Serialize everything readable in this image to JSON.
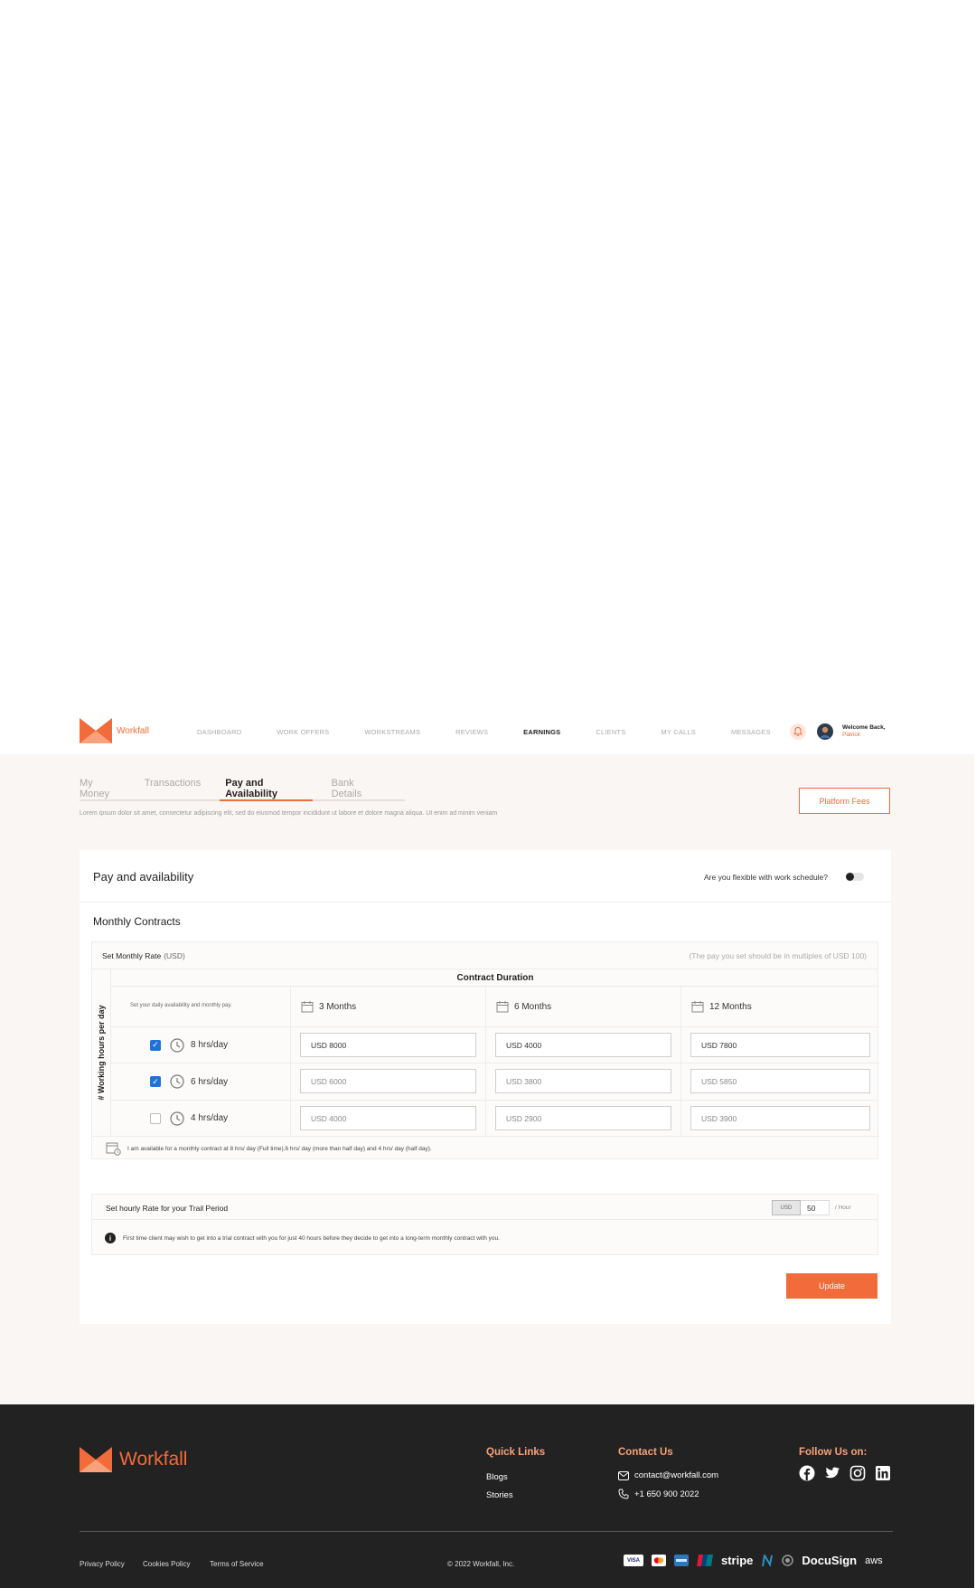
{
  "brand": {
    "name": "Workfall",
    "accent": "#f26b3a"
  },
  "nav": {
    "items": [
      "DASHBOARD",
      "WORK OFFERS",
      "WORKSTREAMS",
      "REVIEWS",
      "EARNINGS",
      "CLIENTS",
      "MY CALLS",
      "MESSAGES"
    ],
    "active": "EARNINGS"
  },
  "user": {
    "welcome": "Welcome Back,",
    "name": "Patrick"
  },
  "tabs": [
    "My Money",
    "Transactions",
    "Pay and Availability",
    "Bank Details"
  ],
  "page": {
    "subtitle": "Lorem ipsum dolor sit amet, consectetur adipiscing elit, sed do eiusmod tempor incididunt ut labore et dolore magna aliqua. Ut enim ad minim veniam",
    "platform_fees": "Platform Fees"
  },
  "card": {
    "title": "Pay and availability",
    "flexible_question": "Are you flexible with work schedule?",
    "monthly_title": "Monthly Contracts",
    "rate_label": "Set Monthly Rate",
    "rate_currency": "(USD)",
    "rate_note": "(The pay you set should be in multiples of USD 100)",
    "vertical_label": "# Working hours per day",
    "contract_duration": "Contract Duration",
    "availability_hint": "Set your daily availability and monthly pay.",
    "durations": [
      "3 Months",
      "6 Months",
      "12 Months"
    ],
    "rows": [
      {
        "hours": "8 hrs/day",
        "checked": true,
        "values": [
          "USD 8000",
          "USD 4000",
          "USD 7800"
        ]
      },
      {
        "hours": "6 hrs/day",
        "checked": true,
        "values": [
          "USD 6000",
          "USD 3800",
          "USD 5850"
        ]
      },
      {
        "hours": "4 hrs/day",
        "checked": false,
        "values": [
          "USD 4000",
          "USD 2900",
          "USD 3900"
        ]
      }
    ],
    "availability_note": "I am available for a monthly contract at 8 hrs/ day (Full time),6 hrs/ day (more than half day) and 4 hrs/ day (half day).",
    "trial_label": "Set hourly Rate for your Trail Period",
    "trial_currency": "USD",
    "trial_value": "50",
    "trial_unit": "/ Hour",
    "trial_note": "First time client may wish to get into a trial contract with you for just 40 hours before they decide to get into a long-term monthly contract with you.",
    "update": "Update"
  },
  "footer": {
    "brand": "Workfall",
    "quick_links_title": "Quick Links",
    "quick_links": [
      "Blogs",
      "Stories"
    ],
    "contact_title": "Contact Us",
    "email": "contact@workfall.com",
    "phone": "+1 650 900 2022",
    "follow_title": "Follow Us on:",
    "legal": [
      "Privacy Policy",
      "Cookies Policy",
      "Terms of Service"
    ],
    "copyright": "© 2022 Workfall, Inc.",
    "partners": [
      "VISA",
      "stripe",
      "DocuSign",
      "aws"
    ]
  }
}
